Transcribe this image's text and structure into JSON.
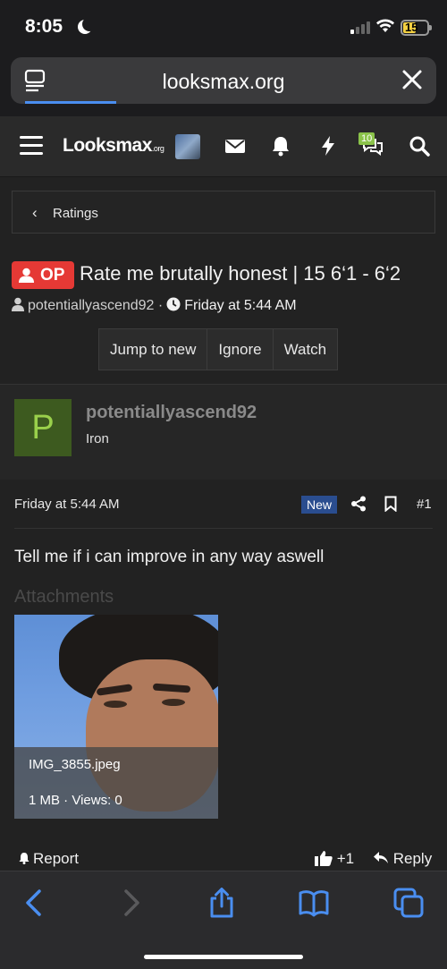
{
  "status": {
    "time": "8:05",
    "battery": "15"
  },
  "browser": {
    "url": "looksmax.org"
  },
  "site": {
    "logo_main": "Looksmax",
    "logo_suffix": ".org",
    "alerts_count": "10"
  },
  "breadcrumb": {
    "label": "Ratings"
  },
  "thread": {
    "badge": "OP",
    "title": "Rate me brutally honest | 15 6‘1 - 6‘2",
    "author": "potentiallyascend92",
    "separator": "·",
    "date": "Friday at 5:44 AM",
    "buttons": [
      "Jump to new",
      "Ignore",
      "Watch"
    ]
  },
  "post": {
    "avatar_letter": "P",
    "username": "potentiallyascend92",
    "rank": "Iron",
    "date": "Friday at 5:44 AM",
    "new_label": "New",
    "number": "#1",
    "text": "Tell me if i can improve in any way aswell",
    "attachments_label": "Attachments",
    "attachment": {
      "filename": "IMG_3855.jpeg",
      "info": "1 MB · Views: 0"
    },
    "report_label": "Report",
    "like_count": "+1",
    "reply_label": "Reply"
  },
  "colors": {
    "accent": "#4a8ef0",
    "op_badge": "#e53935",
    "avatar_bg": "#3d5a1f",
    "new_badge": "#2a4d8f"
  }
}
